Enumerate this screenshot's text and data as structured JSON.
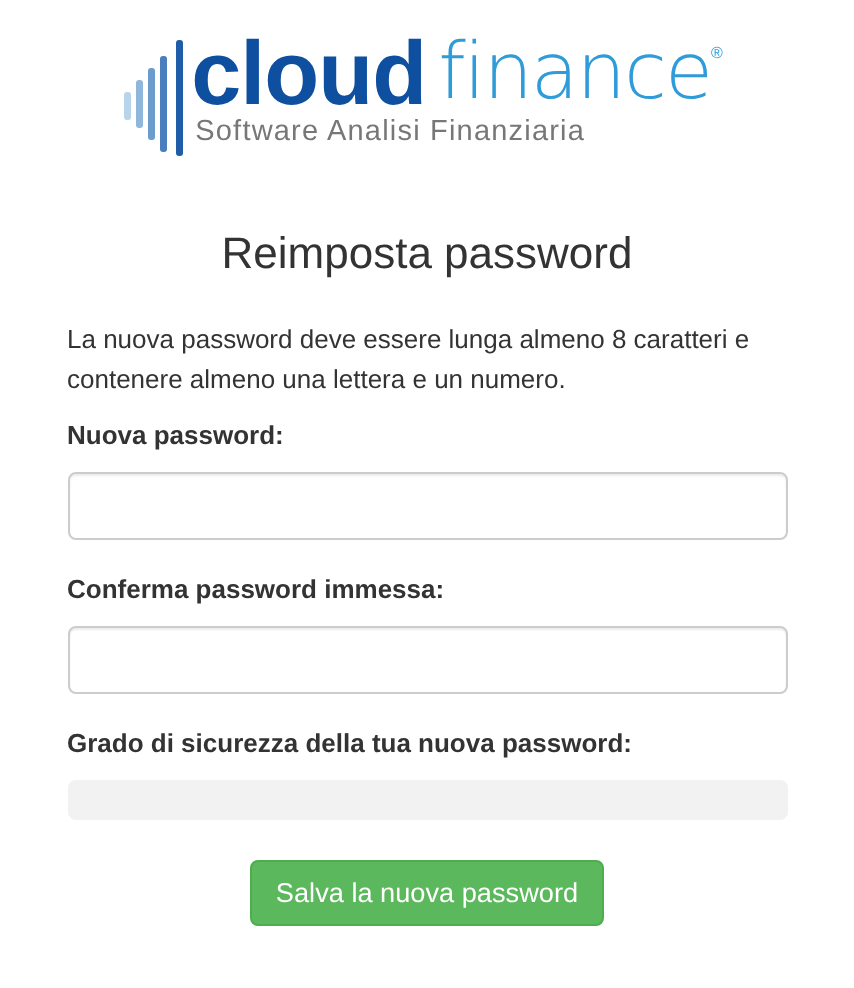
{
  "logo": {
    "brand_bold": "cloud",
    "brand_light": "finance",
    "registered": "®",
    "tagline": "Software Analisi Finanziaria"
  },
  "title": "Reimposta password",
  "instructions": "La nuova password deve essere lunga almeno 8 caratteri e contenere almeno una lettera e un numero.",
  "fields": [
    {
      "label": "Nuova password:"
    },
    {
      "label": "Conferma password immessa:"
    }
  ],
  "strength": {
    "label": "Grado di sicurezza della tua nuova password:",
    "level": 0
  },
  "submit": "Salva la nuova password"
}
